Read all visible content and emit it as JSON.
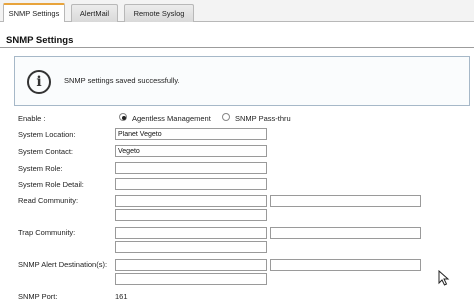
{
  "tabs": [
    {
      "label": "SNMP Settings",
      "active": true
    },
    {
      "label": "AlertMail",
      "active": false
    },
    {
      "label": "Remote Syslog",
      "active": false
    }
  ],
  "section": {
    "title": "SNMP Settings"
  },
  "message": {
    "text": "SNMP settings saved successfully.",
    "icon": "info-icon"
  },
  "form": {
    "enable_label": "Enable :",
    "enable_options": [
      {
        "label": "Agentless Management",
        "selected": true
      },
      {
        "label": "SNMP Pass-thru",
        "selected": false
      }
    ],
    "system_location": {
      "label": "System Location:",
      "value": "Planet Vegeto"
    },
    "system_contact": {
      "label": "System Contact:",
      "value": "Vegeto"
    },
    "system_role": {
      "label": "System Role:",
      "value": ""
    },
    "system_role_detail": {
      "label": "System Role Detail:",
      "value": ""
    },
    "read_community": {
      "label": "Read Community:",
      "values": [
        "",
        "",
        ""
      ]
    },
    "trap_community": {
      "label": "Trap Community:",
      "values": [
        "",
        "",
        ""
      ]
    },
    "snmp_alert_destinations": {
      "label": "SNMP Alert Destination(s):",
      "values": [
        "",
        "",
        ""
      ]
    },
    "snmp_port": {
      "label": "SNMP Port:",
      "value": "161"
    }
  }
}
